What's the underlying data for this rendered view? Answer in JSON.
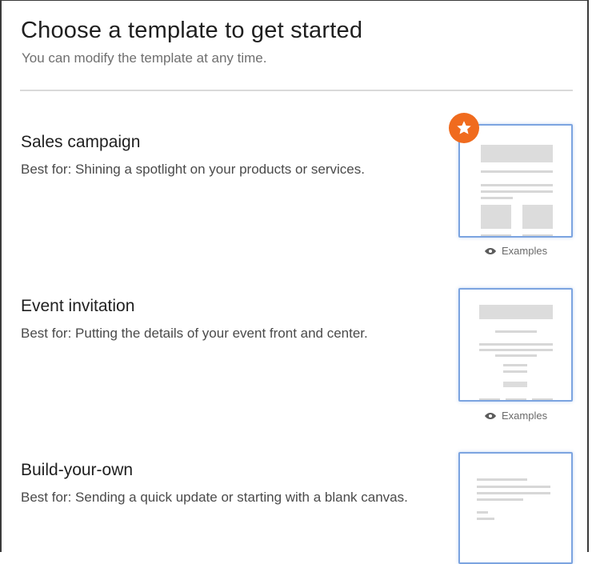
{
  "header": {
    "title": "Choose a template to get started",
    "subtitle": "You can modify the template at any time."
  },
  "options": [
    {
      "title": "Sales campaign",
      "description": "Best for: Shining a spotlight on your products or services.",
      "featured": true,
      "examples_label": "Examples"
    },
    {
      "title": "Event invitation",
      "description": "Best for: Putting the details of your event front and center.",
      "featured": false,
      "examples_label": "Examples"
    },
    {
      "title": "Build-your-own",
      "description": "Best for: Sending a quick update or starting with a blank canvas.",
      "featured": false
    }
  ],
  "colors": {
    "accent_badge": "#f06b1e",
    "thumb_border": "#7ca4e0"
  },
  "icons": {
    "featured": "star-icon",
    "examples": "eye-icon"
  }
}
